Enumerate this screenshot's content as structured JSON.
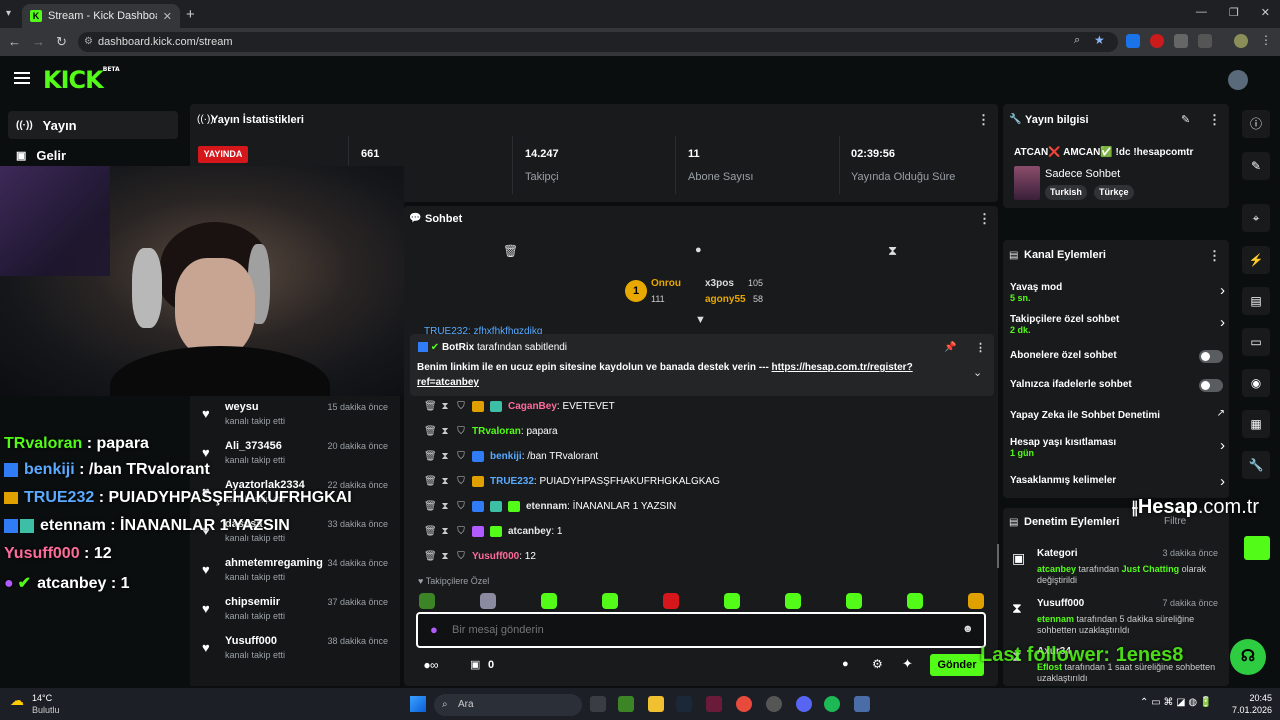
{
  "browser": {
    "tab_title": "Stream - Kick Dashboard",
    "url": "dashboard.kick.com/stream"
  },
  "brand": {
    "logo": "KICK",
    "beta": "BETA",
    "accent": "#53fc18"
  },
  "sidebar": {
    "items": [
      {
        "label": "Yayın",
        "icon": "broadcast-icon"
      },
      {
        "label": "Gelir",
        "icon": "revenue-icon"
      }
    ]
  },
  "stats": {
    "title": "Yayın İstatistikleri",
    "live_badge": "YAYINDA",
    "viewers": "661",
    "followers_value": "14.247",
    "followers_label": "Takipçi",
    "subs_value": "11",
    "subs_label": "Abone Sayısı",
    "uptime_value": "02:39:56",
    "uptime_label": "Yayında Olduğu Süre"
  },
  "overlay_chat": [
    {
      "user": "TRvaloran",
      "text": " : papara",
      "color": "#53fc18"
    },
    {
      "user": "benkiji",
      "text": " : /ban TRvalorant",
      "color": "#5aaaff"
    },
    {
      "user": "TRUE232",
      "text": " : PUIADYHPASŞFHAKUFRHGKAI",
      "color": "#5aaaff"
    },
    {
      "user": "etennam",
      "text": " : İNANANLAR 1 YAZSIN",
      "color": "#fff"
    },
    {
      "user": "Yusuff000",
      "text": " : 12",
      "color": "#ff6b9b"
    },
    {
      "user": "atcanbey",
      "text": " : 1",
      "color": "#fff"
    }
  ],
  "followers": [
    {
      "name": "weysu",
      "sub": "kanalı takip etti",
      "time": "15 dakika önce"
    },
    {
      "name": "Ali_373456",
      "sub": "kanalı takip etti",
      "time": "20 dakika önce"
    },
    {
      "name": "Ayaztorlak2334",
      "sub": "kanalı takip etti",
      "time": "22 dakika önce"
    },
    {
      "name": "dasssa",
      "sub": "kanalı takip etti",
      "time": "33 dakika önce"
    },
    {
      "name": "ahmetemregaming",
      "sub": "kanalı takip etti",
      "time": "34 dakika önce"
    },
    {
      "name": "chipsemiir",
      "sub": "kanalı takip etti",
      "time": "37 dakika önce"
    },
    {
      "name": "Yusuff000",
      "sub": "kanalı takip etti",
      "time": "38 dakika önce"
    }
  ],
  "chat": {
    "title": "Sohbet",
    "leaderboard": [
      {
        "name": "Onrou",
        "value": "111"
      },
      {
        "name": "x3pos",
        "value": "105"
      },
      {
        "name": "agony55",
        "value": "58"
      }
    ],
    "pinned_by": "BotRix",
    "pinned_suffix": "tarafından sabitlendi",
    "pinned_text": "Benim linkim ile en ucuz epin sitesine kaydolun ve banada destek verin --- ",
    "pinned_link": "https://hesap.com.tr/register?ref=atcanbey",
    "partial_msg": "TRUE232: zfhxfhkfhgzdjkg",
    "messages": [
      {
        "user": "CaganBey",
        "text": ": EVETEVET",
        "color": "#ff6b9b"
      },
      {
        "user": "TRvaloran",
        "text": ": papara",
        "color": "#53fc18"
      },
      {
        "user": "benkiji",
        "text": ": /ban TRvalorant",
        "color": "#5aaaff"
      },
      {
        "user": "TRUE232",
        "text": ": PUIADYHPASŞFHAKUFRHGKALGKAG",
        "color": "#5aaaff"
      },
      {
        "user": "etennam",
        "text": ": İNANANLAR 1 YAZSIN",
        "color": "#e8e8e8"
      },
      {
        "user": "atcanbey",
        "text": ": 1",
        "color": "#e8e8e8"
      },
      {
        "user": "Yusuff000",
        "text": ": 12",
        "color": "#ff6b9b"
      }
    ],
    "followers_only": "Takipçilere Özel",
    "placeholder": "Bir mesaj gönderin",
    "points": "0",
    "send": "Gönder"
  },
  "stream_info": {
    "title": "Yayın bilgisi",
    "stream_title": "ATCAN❌ AMCAN✅ !dc !hesapcomtr",
    "category": "Sadece Sohbet",
    "tags": [
      "Turkish",
      "Türkçe"
    ]
  },
  "channel_actions": {
    "title": "Kanal Eylemleri",
    "slow_mode": "Yavaş mod",
    "slow_mode_value": "5 sn.",
    "followers_chat": "Takipçilere özel sohbet",
    "followers_chat_value": "2 dk.",
    "subs_chat": "Abonelere özel sohbet",
    "emotes_chat": "Yalnızca ifadelerle sohbet",
    "ai_mod": "Yapay Zeka ile Sohbet Denetimi",
    "age_limit": "Hesap yaşı kısıtlaması",
    "age_limit_value": "1 gün",
    "banned_words": "Yasaklanmış kelimeler"
  },
  "mod_actions": {
    "title": "Denetim Eylemleri",
    "filter": "Filtre",
    "entries": [
      {
        "title": "Kategori",
        "time": "3 dakika önce",
        "by": "atcanbey",
        "mid": " tarafından ",
        "hl": "Just Chatting",
        "rest": " olarak değiştirildi"
      },
      {
        "title": "Yusuff000",
        "time": "7 dakika önce",
        "by": "etennam",
        "mid": " tarafından 5 dakika süreliğine sohbetten uzaklaştırıldı",
        "hl": "",
        "rest": ""
      },
      {
        "title": "Axur34",
        "time": "",
        "by": "Eflost",
        "mid": " tarafından 1 saat süreliğine sohbetten uzaklaştırıldı",
        "hl": "",
        "rest": ""
      }
    ]
  },
  "watermark": {
    "brand": "Hesap",
    "domain": ".com.tr",
    "last_follower": "Last follower: 1enes8"
  },
  "taskbar": {
    "weather_temp": "14°C",
    "weather_desc": "Bulutlu",
    "search": "Ara",
    "time": "20:45",
    "date": "7.01.2026"
  }
}
